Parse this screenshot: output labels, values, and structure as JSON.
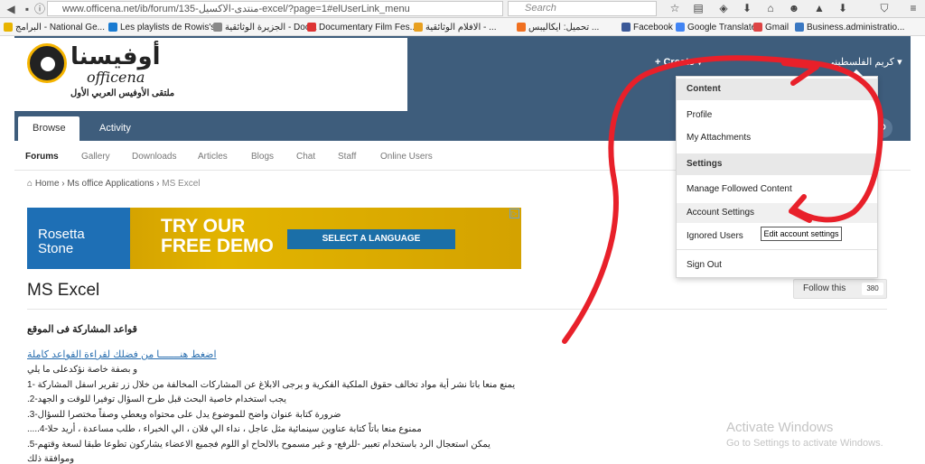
{
  "browser": {
    "url": "www.officena.net/ib/forum/135-منتدى-الاكسيل-excel/?page=1#elUserLink_menu",
    "search_placeholder": "Search",
    "bookmarks": [
      "البرامج - National Ge...",
      "Les playlists de Rowis's...",
      "الجزيرة الوثائقية - Doc...",
      "Documentary Film Fes...",
      "الافلام الوثائقية - ...",
      "تحميل: ايكاليبس ...",
      "Facebook",
      "Google Translate",
      "Gmail",
      "Business.administratio..."
    ]
  },
  "site": {
    "logo_arabic": "أوفيسنا",
    "logo_english": "officena",
    "logo_tagline": "ملتقى الأوفيس العربي الأول",
    "create_label": "+ Create ▾",
    "user_name": "كريم الفلسطيني ▾",
    "tabs": [
      "Browse",
      "Activity"
    ],
    "subnav": [
      "Forums",
      "Gallery",
      "Downloads",
      "Articles",
      "Blogs",
      "Chat",
      "Staff",
      "Online Users"
    ],
    "breadcrumb": [
      "Home",
      "Ms office Applications",
      "MS Excel"
    ],
    "ad": {
      "brand": "Rosetta Stone",
      "headline_1": "TRY OUR",
      "headline_2": "FREE DEMO",
      "cta": "SELECT A LANGUAGE"
    },
    "forum_title": "MS Excel",
    "follow_label": "Follow this",
    "follow_count": "380",
    "rules_heading": "قواعد المشاركة فى الموقع",
    "rules_link": "اضغط هنـــــــا من فضلك لقراءة القواعد كاملة",
    "rules": [
      "و بصفة خاصة نؤكدعلى ما يلي",
      "يمنع منعا باتا نشر أية مواد تخالف حقوق الملكية الفكرية و يرجى الابلاغ عن المشاركات المخالفة من خلال زر تقرير اسفل المشاركة -1",
      "يجب استخدام خاصية البحث قبل طرح السؤال توفيرا للوقت و الجهد-2.",
      "ضرورة كتابة عنوان واضح للموضوع يدل على محتواه ويعطي وصفاً مختصرا للسؤال-3.",
      "ممنوع منعا باتاً كتابة عناوين سينمائية مثل عاجل ، نداء الي فلان ، الي الخبراء ، طلب مساعدة ، أريد حلا-4.....",
      "يمكن استعجال الرد باستخدام تعبير -للرفع- و غير مسموح بالالحاح او اللوم فجميع الاعضاء يشاركون تطوعا طبقا لسعة وقتهم-5.",
      "وموافقة ذلك"
    ]
  },
  "dropdown": {
    "heading_content": "Content",
    "profile": "Profile",
    "attachments": "My Attachments",
    "heading_settings": "Settings",
    "followed": "Manage Followed Content",
    "account_settings": "Account Settings",
    "ignored": "Ignored Users",
    "sign_out": "Sign Out",
    "tooltip": "Edit account settings"
  },
  "windows": {
    "activate_title": "Activate Windows",
    "activate_hint": "Go to Settings to activate Windows."
  },
  "colors": {
    "header": "#3e5d7c",
    "annotation": "#e8202a",
    "link": "#2a6fb0"
  }
}
